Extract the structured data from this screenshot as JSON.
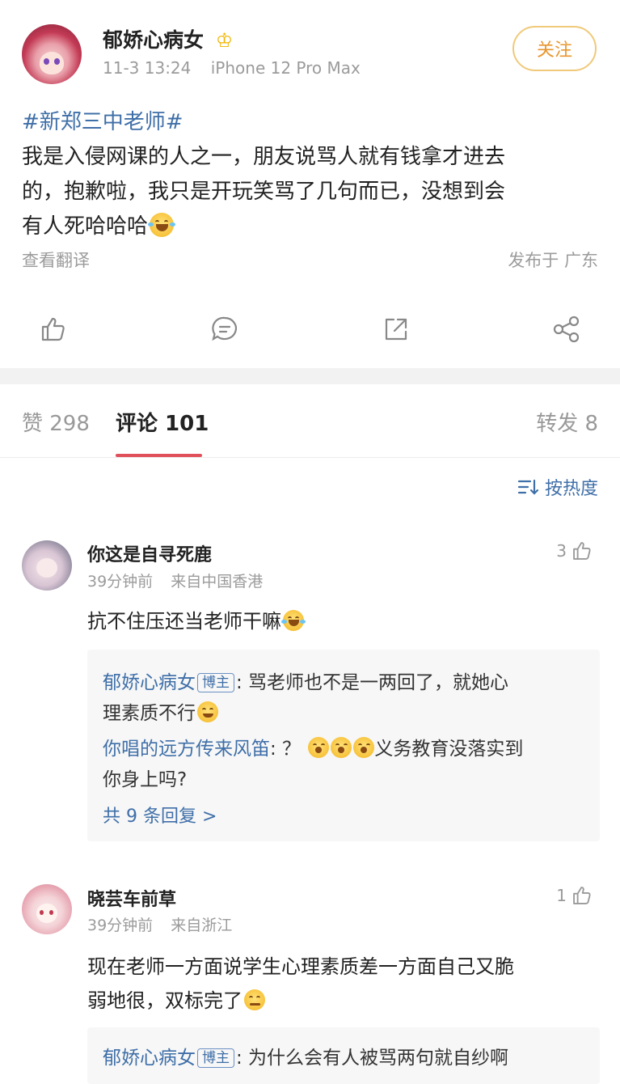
{
  "post": {
    "author": "郁娇心病女",
    "crown": "♔",
    "time": "11-3 13:24",
    "device": "iPhone 12 Pro Max",
    "follow_label": "关注",
    "hashtag": "#新郑三中老师#",
    "body_line1": "我是入侵网课的人之一，朋友说骂人就有钱拿才进去",
    "body_line2": "的，抱歉啦，我只是开玩笑骂了几句而已，没想到会",
    "body_line3": "有人死哈哈哈",
    "translate": "查看翻译",
    "location": "发布于 广东"
  },
  "tabs": {
    "likes": "赞 298",
    "comments": "评论 101",
    "reposts": "转发 8"
  },
  "sort": {
    "label": "按热度"
  },
  "comments": [
    {
      "user": "你这是自寻死鹿",
      "likes": "3",
      "time": "39分钟前",
      "location": "来自中国香港",
      "text": "抗不住压还当老师干嘛",
      "replies": [
        {
          "user": "郁娇心病女",
          "badge": "博主",
          "text1": ": 骂老师也不是一两回了，就她心",
          "text2": "理素质不行"
        },
        {
          "user": "你唱的远方传来风笛",
          "text1": ": ？",
          "text1b": "义务教育没落实到",
          "text2": "你身上吗?"
        }
      ],
      "more": "共 9 条回复 >"
    },
    {
      "user": "晓芸车前草",
      "likes": "1",
      "time": "39分钟前",
      "location": "来自浙江",
      "text1": "现在老师一方面说学生心理素质差一方面自己又脆",
      "text2": "弱地很，双标完了",
      "replies": [
        {
          "user": "郁娇心病女",
          "badge": "博主",
          "text1": ": 为什么会有人被骂两句就自纱啊"
        }
      ]
    }
  ],
  "colors": {
    "link": "#3f6fa8",
    "accent_red": "#e0505a",
    "follow_border": "#f0c97a",
    "follow_text": "#e8962e"
  },
  "icons": [
    "thumb-up-icon",
    "comment-icon",
    "repost-icon",
    "share-icon",
    "sort-icon",
    "crown-icon",
    "laugh-cry-emoji"
  ]
}
